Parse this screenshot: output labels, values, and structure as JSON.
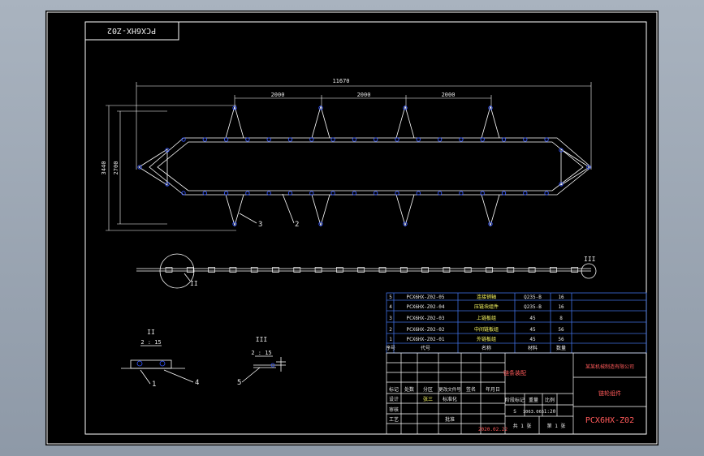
{
  "drawing": {
    "code_rotated": "PCX6HX-Z02",
    "overall_length": "11670",
    "pitch_1": "2000",
    "pitch_2": "2000",
    "pitch_3": "2000",
    "height_outer": "3440",
    "height_inner": "2700",
    "callouts": [
      "2",
      "3",
      "1",
      "4",
      "5"
    ],
    "detail_ii_mark": "II",
    "detail_iii_mark": "III",
    "detail_ii_title": "II",
    "detail_ii_scale": "2 : 15",
    "detail_iii_title": "III",
    "detail_iii_scale": "2 : 15"
  },
  "bom": {
    "rows": [
      {
        "no": "5",
        "code": "PCX6HX-Z02-05",
        "name": "连接销轴",
        "material": "Q235-B",
        "qty": "16"
      },
      {
        "no": "4",
        "code": "PCX6HX-Z02-04",
        "name": "压链块组件",
        "material": "Q235-B",
        "qty": "16"
      },
      {
        "no": "3",
        "code": "PCX6HX-Z02-03",
        "name": "上链板组",
        "material": "45",
        "qty": "8"
      },
      {
        "no": "2",
        "code": "PCX6HX-Z02-02",
        "name": "中间链板组",
        "material": "45",
        "qty": "56"
      },
      {
        "no": "1",
        "code": "PCX6HX-Z02-01",
        "name": "外链板组",
        "material": "45",
        "qty": "56"
      }
    ],
    "header": {
      "no": "序号",
      "code": "代号",
      "name": "名称",
      "qty": "数量",
      "material": "材料"
    }
  },
  "title_block": {
    "company": "某某机械制造有限公司",
    "part_name": "链条装配",
    "assembly": "链轮组件",
    "drawing_no": "PCX6HX-Z02",
    "label_stage": "阶段标记",
    "label_weight": "重量",
    "label_scale": "比例",
    "stage_value": "S",
    "weight_value": "1063.065",
    "scale_value": "1:20",
    "sheet_total": "共 1 张",
    "sheet_no": "第 1 张",
    "date": "2020.02.22",
    "label_mark": "标记",
    "label_count": "处数",
    "label_zone": "分区",
    "label_change_doc": "更改文件号",
    "label_sign": "签名",
    "label_ymd": "年月日",
    "label_design": "设计",
    "label_check": "审核",
    "label_process": "工艺",
    "label_standard": "标准化",
    "label_approve": "批准",
    "designer": "张三"
  },
  "colors": {
    "background": "#000000",
    "frame": "#ffffff",
    "primary": "#ffffff",
    "bom_lines": "#3f6fe0",
    "pins": "#3355ff",
    "accent_text": "#ff5a5a",
    "label_text": "#ffff66"
  }
}
